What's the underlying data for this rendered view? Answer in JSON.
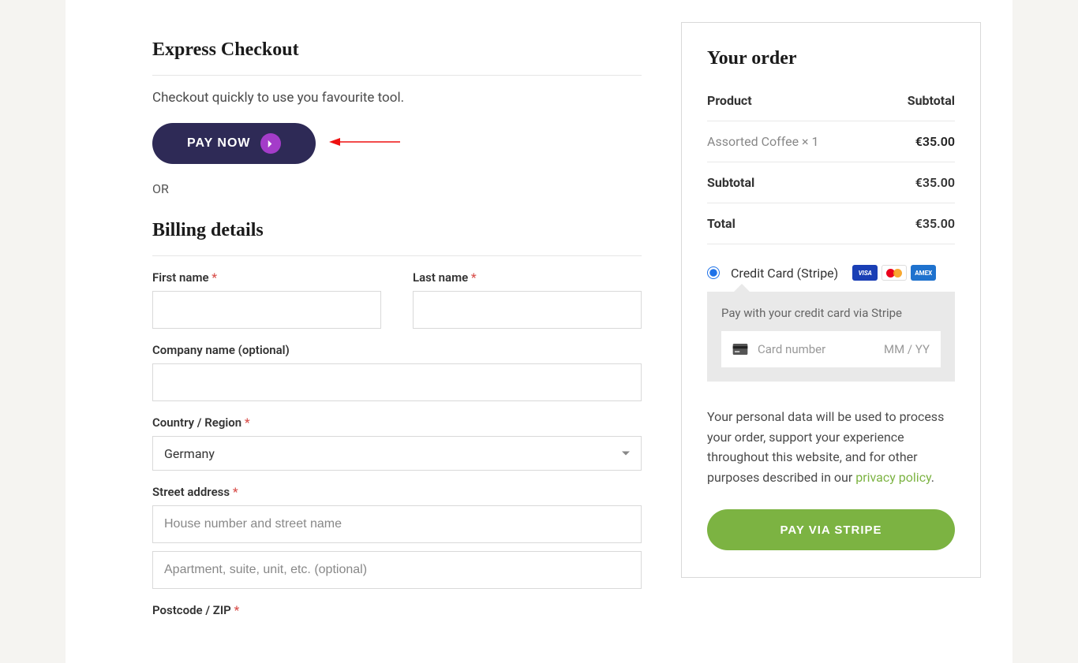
{
  "express": {
    "title": "Express Checkout",
    "subtitle": "Checkout quickly to use you favourite tool.",
    "pay_now_label": "PAY NOW",
    "or_label": "OR"
  },
  "billing": {
    "title": "Billing details",
    "first_name_label": "First name",
    "last_name_label": "Last name",
    "company_label": "Company name (optional)",
    "country_label": "Country / Region",
    "country_value": "Germany",
    "street_label": "Street address",
    "street_placeholder": "House number and street name",
    "street2_placeholder": "Apartment, suite, unit, etc. (optional)",
    "postcode_label": "Postcode / ZIP",
    "required_marker": "*"
  },
  "order": {
    "title": "Your order",
    "header_product": "Product",
    "header_subtotal": "Subtotal",
    "item_name": "Assorted Coffee  × 1",
    "item_amount": "€35.00",
    "subtotal_label": "Subtotal",
    "subtotal_amount": "€35.00",
    "total_label": "Total",
    "total_amount": "€35.00"
  },
  "payment": {
    "method_label": "Credit Card (Stripe)",
    "visa_text": "VISA",
    "amex_text": "AMEX",
    "stripe_desc": "Pay with your credit card via Stripe",
    "card_number_placeholder": "Card number",
    "card_expiry_placeholder": "MM / YY"
  },
  "privacy": {
    "text": "Your personal data will be used to process your order, support your experience throughout this website, and for other purposes described in our ",
    "link_text": "privacy policy",
    "suffix": "."
  },
  "submit": {
    "label": "PAY VIA STRIPE"
  }
}
